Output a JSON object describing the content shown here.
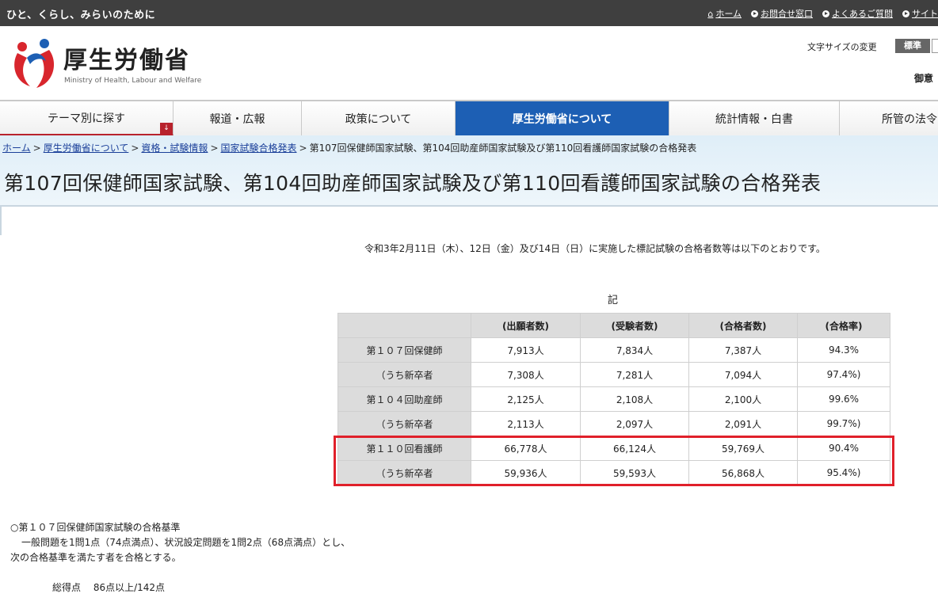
{
  "topbar": {
    "tagline": "ひと、くらし、みらいのために",
    "links": [
      "ホーム",
      "お問合せ窓口",
      "よくあるご質問",
      "サイト"
    ]
  },
  "header": {
    "logo_jp": "厚生労働省",
    "logo_en": "Ministry of Health, Labour and Welfare",
    "fontsize_label": "文字サイズの変更",
    "fontsize_standard": "標準",
    "goiken": "御意"
  },
  "nav": {
    "items": [
      "テーマ別に探す",
      "報道・広報",
      "政策について",
      "厚生労働省について",
      "統計情報・白書",
      "所管の法令"
    ],
    "active_index": 3
  },
  "breadcrumb": {
    "links": [
      "ホーム",
      "厚生労働省について",
      "資格・試験情報",
      "国家試験合格発表"
    ],
    "current": "第107回保健師国家試験、第104回助産師国家試験及び第110回看護師国家試験の合格発表"
  },
  "page_title": "第107回保健師国家試験、第104回助産師国家試験及び第110回看護師国家試験の合格発表",
  "intro": "令和3年2月11日（木）、12日（金）及び14日（日）に実施した標記試験の合格者数等は以下のとおりです。",
  "ki": "記",
  "table": {
    "headers": [
      "",
      "(出願者数)",
      "(受験者数)",
      "(合格者数)",
      "(合格率)"
    ],
    "rows": [
      {
        "label": "第１０７回保健師",
        "cells": [
          "7,913人",
          "7,834人",
          "7,387人",
          "94.3%"
        ]
      },
      {
        "label": "（うち新卒者",
        "cells": [
          "7,308人",
          "7,281人",
          "7,094人",
          "97.4%)"
        ]
      },
      {
        "label": "第１０４回助産師",
        "cells": [
          "2,125人",
          "2,108人",
          "2,100人",
          "99.6%"
        ]
      },
      {
        "label": "（うち新卒者",
        "cells": [
          "2,113人",
          "2,097人",
          "2,091人",
          "99.7%)"
        ]
      },
      {
        "label": "第１１０回看護師",
        "cells": [
          "66,778人",
          "66,124人",
          "59,769人",
          "90.4%"
        ]
      },
      {
        "label": "（うち新卒者",
        "cells": [
          "59,936人",
          "59,593人",
          "56,868人",
          "95.4%)"
        ]
      }
    ]
  },
  "criteria": {
    "heading": "○第１０７回保健師国家試験の合格基準",
    "line1": "一般問題を1問1点（74点満点）、状況設定問題を1問2点（68点満点）とし、",
    "line2": "次の合格基準を満たす者を合格とする。",
    "total": "総得点　 86点以上/142点"
  },
  "colors": {
    "topbar": "#3f3f3f",
    "nav_active": "#1d5fb4",
    "highlight": "#e0202a",
    "logo_red": "#d8262d",
    "logo_blue": "#1d5fb4"
  }
}
